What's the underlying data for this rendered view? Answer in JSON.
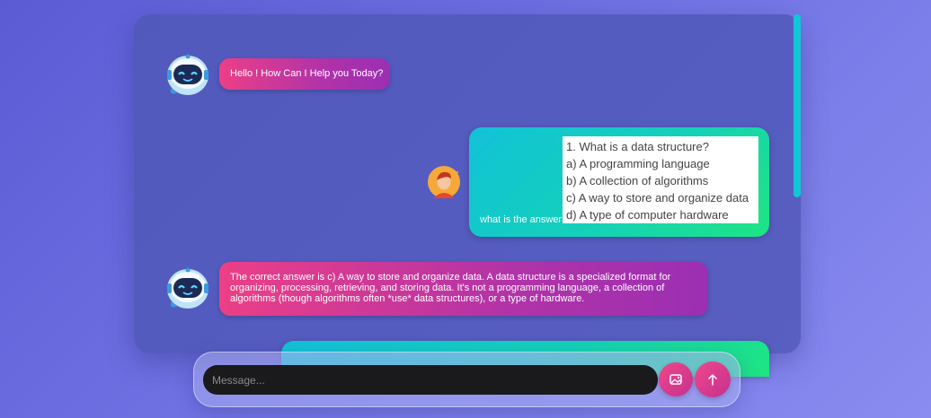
{
  "messages": [
    {
      "from": "bot",
      "text": "Hello ! How Can I Help you Today?"
    },
    {
      "from": "user",
      "caption": "what is the answer",
      "attachment_lines": [
        "1. What is a data structure?",
        "a) A programming language",
        "b) A collection of algorithms",
        "c) A way to store and organize data",
        "d) A type of computer hardware"
      ]
    },
    {
      "from": "bot",
      "text": "The correct answer is c) A way to store and organize data. A data structure is a specialized format for organizing, processing, retrieving, and storing data. It's not a programming language, a collection of algorithms (though algorithms often *use* data structures), or a type of hardware."
    }
  ],
  "input": {
    "placeholder": "Message...",
    "value": ""
  },
  "icons": {
    "bot_avatar": "robot-icon",
    "user_avatar": "user-avatar-icon",
    "image_button": "image-upload-icon",
    "send_button": "arrow-up-icon"
  },
  "colors": {
    "bot_bubble": "#ec3f86",
    "user_bubble": "#12c2d8",
    "accent": "#10c7d6"
  }
}
